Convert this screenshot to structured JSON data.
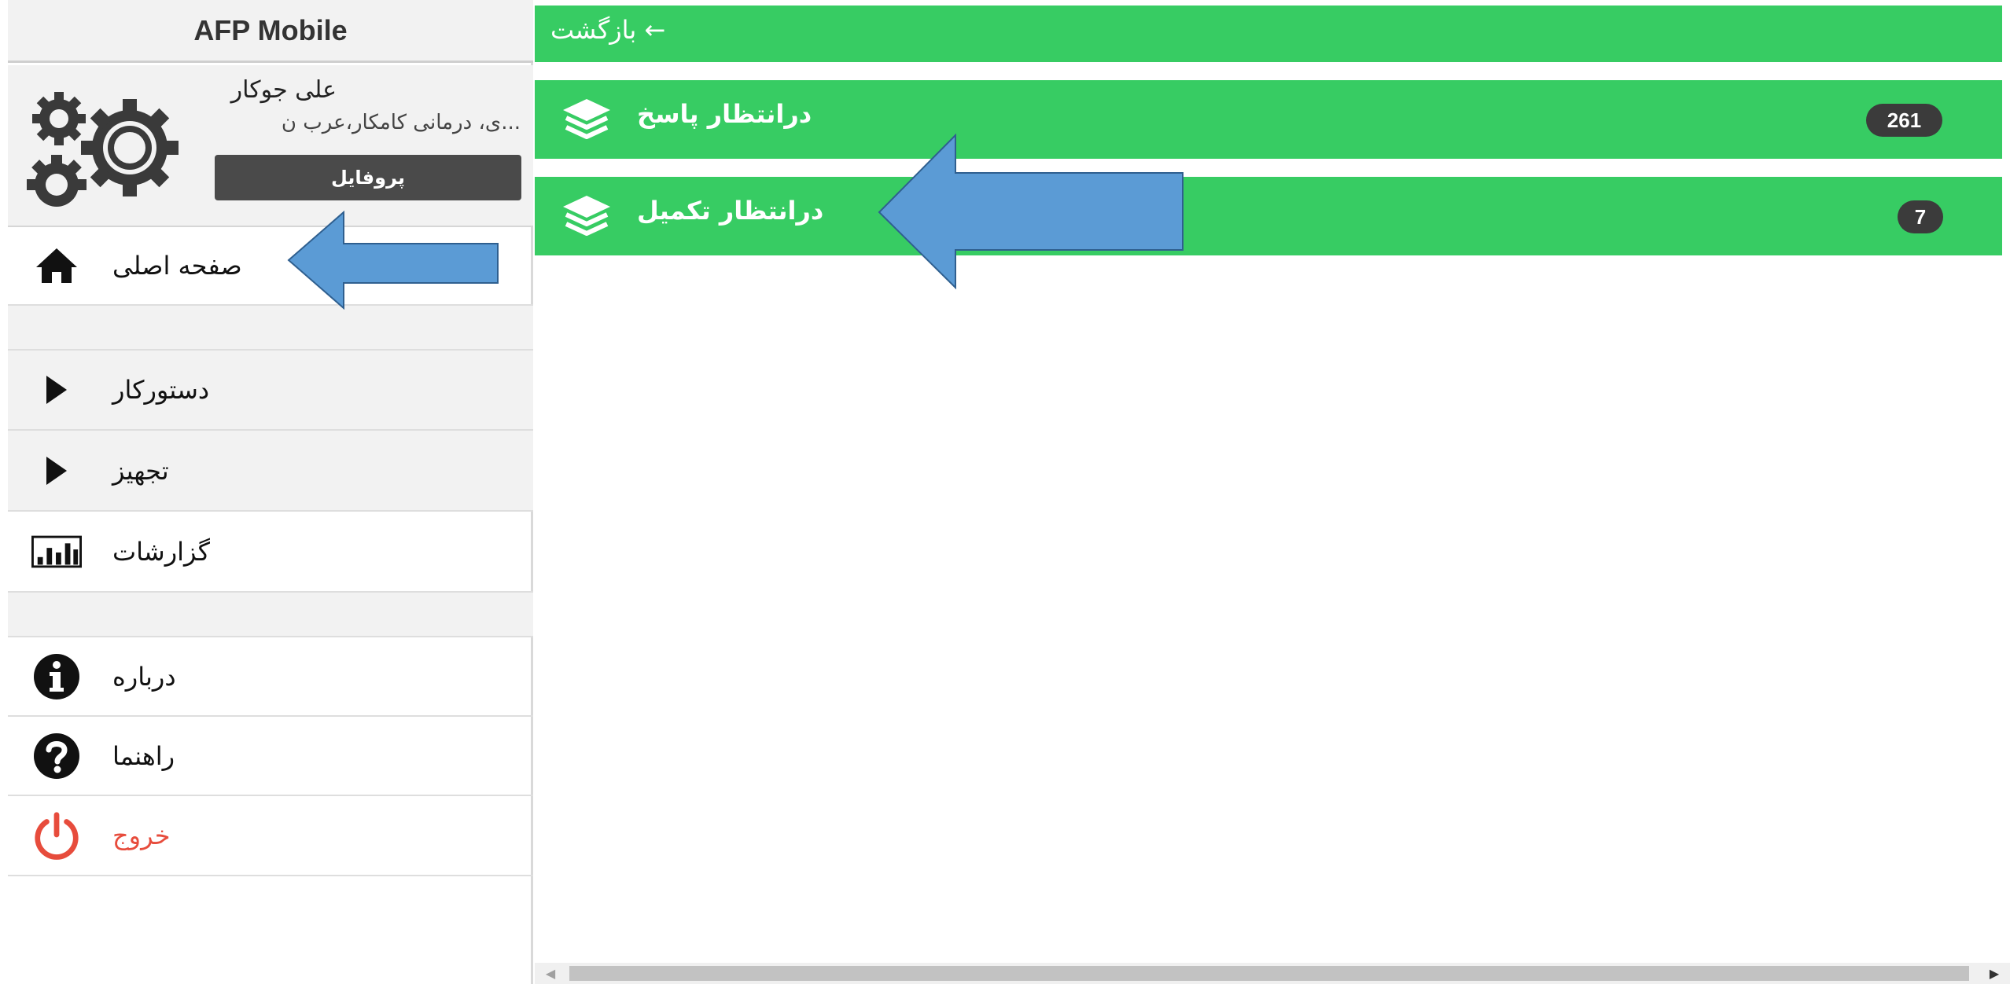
{
  "app": {
    "title": "AFP Mobile"
  },
  "profile": {
    "name": "علی جوکار",
    "department": "...ی، درمانی کامکار،عرب ن",
    "button_label": "پروفایل"
  },
  "sidebar": {
    "items": [
      {
        "label": "صفحه اصلی",
        "icon": "home-icon"
      },
      {
        "label": "دستورکار",
        "icon": "play-icon"
      },
      {
        "label": "تجهیز",
        "icon": "play-icon"
      },
      {
        "label": "گزارشات",
        "icon": "bar-chart-icon"
      },
      {
        "label": "درباره",
        "icon": "info-icon"
      },
      {
        "label": "راهنما",
        "icon": "help-icon"
      },
      {
        "label": "خروج",
        "icon": "power-icon"
      }
    ]
  },
  "main": {
    "back_label": "بازگشت ←",
    "cards": [
      {
        "label": "درانتظار پاسخ",
        "count": "261",
        "icon": "layers-icon"
      },
      {
        "label": "درانتظار تکمیل",
        "count": "7",
        "icon": "layers-icon"
      }
    ]
  },
  "scrollbar": {
    "left_arrow": "◀",
    "right_arrow": "▶"
  },
  "colors": {
    "accent_green": "#37cc63",
    "badge_dark": "#3b3b3b",
    "annotation_blue": "#5b9bd5",
    "logout_red": "#e74c3c"
  }
}
